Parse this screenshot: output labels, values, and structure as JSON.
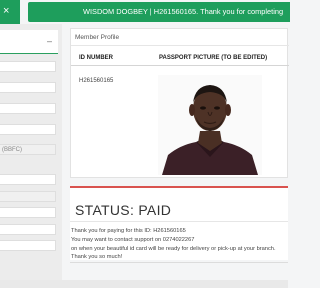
{
  "header": {
    "close_glyph": "×",
    "banner_text": "WISDOM DOGBEY | H261560165. Thank you for completing"
  },
  "sidebar": {
    "collapse_glyph": "–",
    "fields": [
      {
        "value": ""
      },
      {
        "value": ""
      },
      {
        "value": ""
      },
      {
        "value": ""
      },
      {
        "value": "(BBFC)"
      },
      {
        "value": ""
      },
      {
        "value": ""
      },
      {
        "value": ""
      },
      {
        "value": ""
      },
      {
        "value": ""
      }
    ]
  },
  "profile": {
    "title": "Member Profile",
    "col_id": "ID NUMBER",
    "col_photo": "PASSPORT PICTURE (TO BE EDITED)",
    "id_value": "H261560165"
  },
  "status": {
    "title": "STATUS: PAID",
    "lines": [
      "Thank you for paying for this ID: H261560165",
      "You may want to contact support on 0274022267",
      "on when your beautiful id card will be ready for delivery or pick-up at your branch.",
      "Thank you so much!"
    ]
  },
  "colors": {
    "accent_green": "#1e9e5c",
    "status_red": "#d9534f"
  }
}
